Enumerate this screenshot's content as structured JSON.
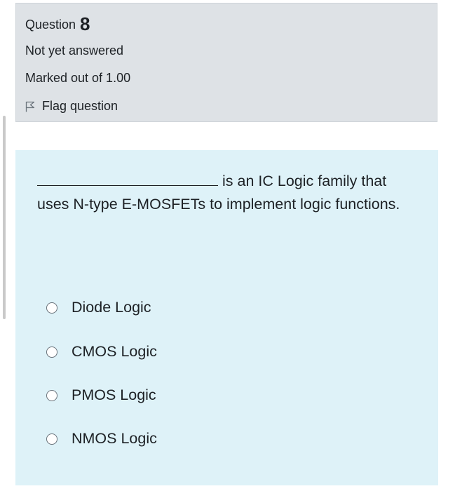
{
  "question": {
    "label": "Question",
    "number": "8",
    "state": "Not yet answered",
    "grade": "Marked out of 1.00",
    "flag_label": "Flag question"
  },
  "prompt": {
    "text_line": "is an IC Logic family that uses N-type E-MOSFETs to implement logic functions."
  },
  "options": [
    {
      "label": "Diode Logic"
    },
    {
      "label": "CMOS Logic"
    },
    {
      "label": "PMOS Logic"
    },
    {
      "label": "NMOS Logic"
    }
  ],
  "colors": {
    "info_bg": "#dee2e6",
    "content_bg": "#def2f8",
    "text": "#1d2125"
  }
}
